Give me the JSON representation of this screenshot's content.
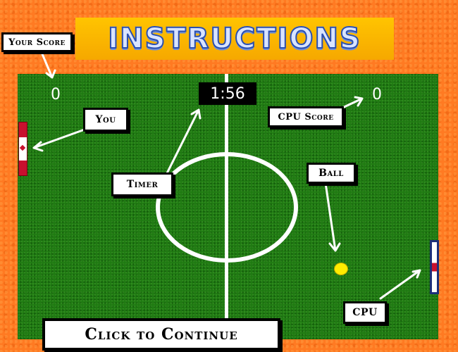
{
  "title": "INSTRUCTIONS",
  "scores": {
    "player": "0",
    "cpu": "0"
  },
  "timer": "1:56",
  "labels": {
    "your_score": "Your Score",
    "you": "You",
    "cpu_score": "CPU Score",
    "timer": "Timer",
    "ball": "Ball",
    "cpu": "CPU"
  },
  "continue_label": "Click to Continue",
  "colors": {
    "background": "#ff7a22",
    "pitch": "#1f7a12",
    "title_banner": "#ffc400",
    "ball": "#ffec00"
  }
}
